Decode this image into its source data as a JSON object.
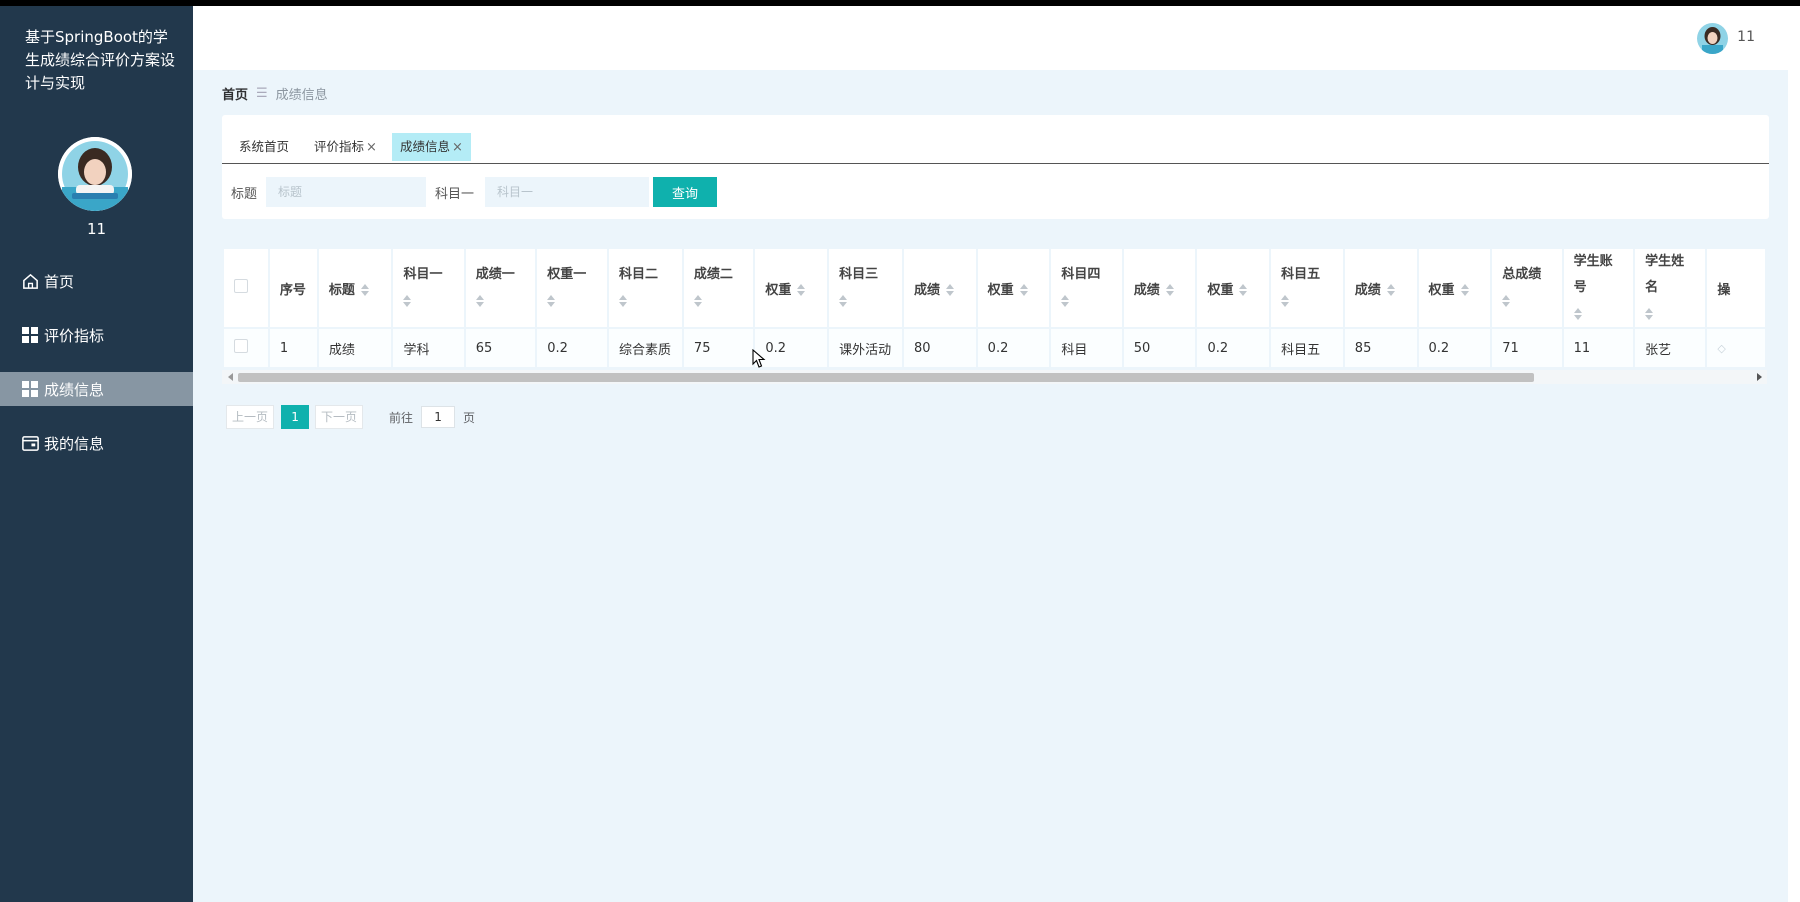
{
  "sidebar": {
    "title": "基于SpringBoot的学生成绩综合评价方案设计与实现",
    "username": "11",
    "menu": [
      {
        "label": "首页",
        "icon": "home-icon",
        "active": false
      },
      {
        "label": "评价指标",
        "icon": "grid-icon",
        "active": false
      },
      {
        "label": "成绩信息",
        "icon": "grid-icon",
        "active": true
      },
      {
        "label": "我的信息",
        "icon": "wallet-icon",
        "active": false
      }
    ]
  },
  "topbar": {
    "username": "11"
  },
  "breadcrumb": {
    "home": "首页",
    "separator": "☰",
    "current": "成绩信息"
  },
  "tabs": [
    {
      "label": "系统首页",
      "closable": false,
      "active": false
    },
    {
      "label": "评价指标",
      "closable": true,
      "active": false
    },
    {
      "label": "成绩信息",
      "closable": true,
      "active": true
    }
  ],
  "search": {
    "title_label": "标题",
    "title_placeholder": "标题",
    "subject1_label": "科目一",
    "subject1_placeholder": "科目一",
    "query_button": "查询"
  },
  "table": {
    "columns": [
      "序号",
      "标题",
      "科目一",
      "成绩一",
      "权重一",
      "科目二",
      "成绩二",
      "权重",
      "科目三",
      "成绩",
      "权重",
      "科目四",
      "成绩",
      "权重",
      "科目五",
      "成绩",
      "权重",
      "总成绩",
      "学生账号",
      "学生姓名",
      "操"
    ],
    "rows": [
      [
        "1",
        "成绩",
        "学科",
        "65",
        "0.2",
        "综合素质",
        "75",
        "0.2",
        "课外活动",
        "80",
        "0.2",
        "科目",
        "50",
        "0.2",
        "科目五",
        "85",
        "0.2",
        "71",
        "11",
        "张艺",
        ""
      ]
    ]
  },
  "pagination": {
    "prev": "上一页",
    "current": "1",
    "next": "下一页",
    "goto_label": "前往",
    "goto_value": "1",
    "unit": "页"
  },
  "colors": {
    "sidebar": "#22384c",
    "accent": "#0fb1ad",
    "active_tab": "#b4ecf6",
    "background": "#ecf5fb"
  }
}
